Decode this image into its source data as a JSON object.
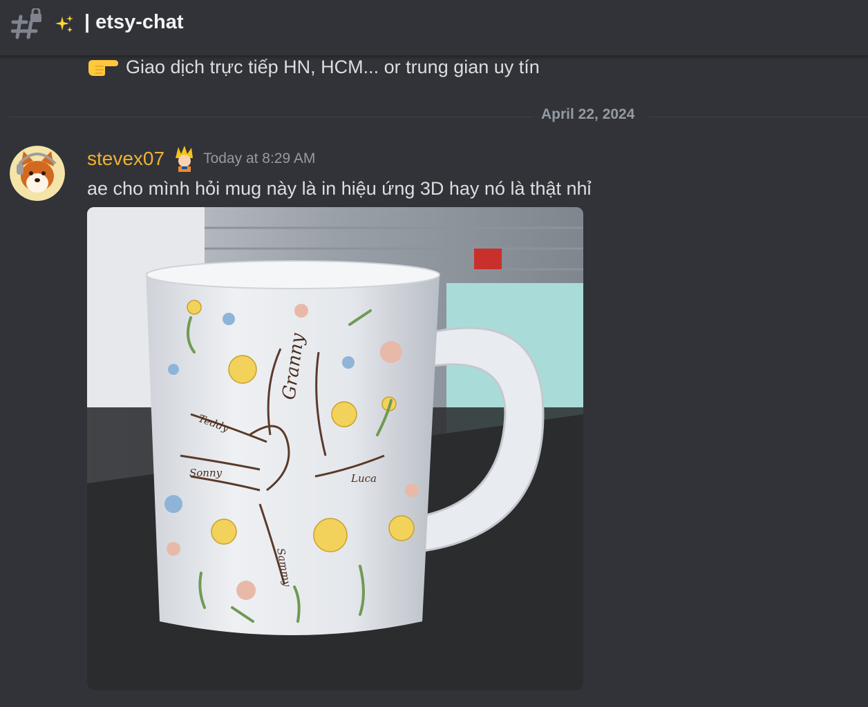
{
  "header": {
    "channel_icon": "hash-lock-icon",
    "emoji": "sparkles-icon",
    "channel_name": "| etsy-chat"
  },
  "previous_message": {
    "emoji": "backhand-pointing-right-icon",
    "text": "Giao dịch trực tiếp HN, HCM... or trung gian uy tín"
  },
  "date_divider": {
    "label": "April 22, 2024"
  },
  "message": {
    "avatar": "shiba-dog-avatar",
    "username": "stevex07",
    "role_icon": "anime-character-icon",
    "timestamp": "Today at 8:29 AM",
    "content": "ae cho mình hỏi mug này là in hiệu ứng 3D hay nó là thật nhỉ",
    "attachment": {
      "kind": "photo",
      "alt": "Photo of a white mug printed with flowers and hands design",
      "mug_print_labels": [
        "Granny",
        "Teddy",
        "Sonny",
        "Luca",
        "Sammy"
      ]
    }
  },
  "colors": {
    "background": "#313338",
    "username": "#f0b232",
    "muted": "#949ba4",
    "text": "#dbdee1"
  }
}
